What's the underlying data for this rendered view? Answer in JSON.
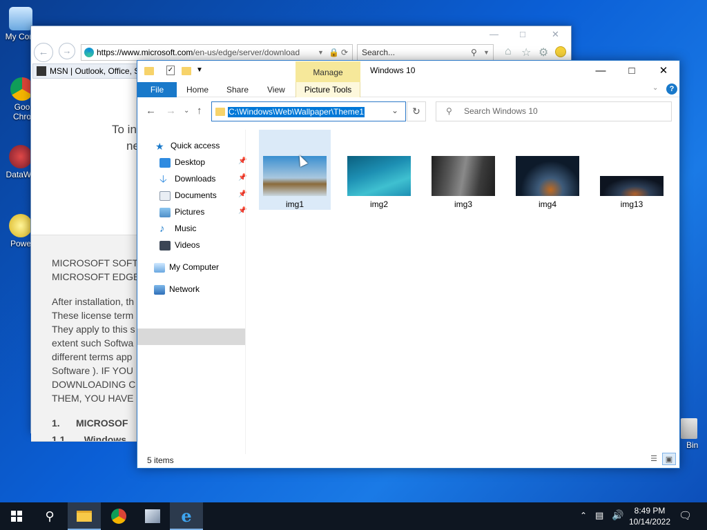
{
  "desktop": {
    "icons": [
      {
        "label": "My Com",
        "icon": "computer-icon"
      },
      {
        "label": "Goo\nChro",
        "icon": "chrome-icon"
      },
      {
        "label": "DataWa",
        "icon": "datawave-icon"
      },
      {
        "label": "Powe",
        "icon": "power-icon"
      },
      {
        "label": "Bin",
        "icon": "recycle-bin-icon"
      }
    ]
  },
  "ie": {
    "address": "https://www.microsoft.com/en-us/edge/server/download",
    "address_domain": "https://www.microsoft.com",
    "address_path": "/en-us/edge/server/download",
    "search_placeholder": "Search...",
    "tab_title": "MSN | Outlook, Office, S",
    "content": {
      "line1": "To in",
      "line2": "ne",
      "heading1": "MICROSOFT SOFTW",
      "heading2": "MICROSOFT EDGE",
      "para": [
        "After installation, th",
        "These license term",
        "They apply to this s",
        "extent such Softwa",
        "different terms app",
        "Software ). IF YOU",
        "DOWNLOADING C",
        "THEM, YOU HAVE"
      ],
      "section1": "1.      MICROSOF",
      "section2": "1.1       Windows"
    }
  },
  "explorer": {
    "title": "Windows 10",
    "manage_label": "Manage",
    "ribbon": {
      "file": "File",
      "home": "Home",
      "share": "Share",
      "view": "View",
      "picture_tools": "Picture Tools"
    },
    "path": "C:\\Windows\\Web\\Wallpaper\\Theme1",
    "search_placeholder": "Search Windows 10",
    "nav": {
      "quick_access": "Quick access",
      "desktop": "Desktop",
      "downloads": "Downloads",
      "documents": "Documents",
      "pictures": "Pictures",
      "music": "Music",
      "videos": "Videos",
      "my_computer": "My Computer",
      "network": "Network"
    },
    "files": [
      {
        "name": "img1",
        "colors": [
          "#3a8fd0",
          "#a9c7de",
          "#8a6a3a"
        ]
      },
      {
        "name": "img2",
        "colors": [
          "#1d8fb3",
          "#3fc0d0",
          "#0b5f7e"
        ]
      },
      {
        "name": "img3",
        "colors": [
          "#3b3b3b",
          "#8a8a8a",
          "#1e1e1e"
        ]
      },
      {
        "name": "img4",
        "colors": [
          "#0d1a2a",
          "#3e5b7a",
          "#c06a20"
        ]
      },
      {
        "name": "img13",
        "colors": [
          "#0d1420",
          "#2e4058",
          "#b0602a"
        ]
      }
    ],
    "status": "5 items"
  },
  "taskbar": {
    "time": "8:49 PM",
    "date": "10/14/2022"
  },
  "colors": {
    "accent": "#0078d7",
    "file_tab": "#1979ca",
    "manage": "#f6e89a"
  }
}
